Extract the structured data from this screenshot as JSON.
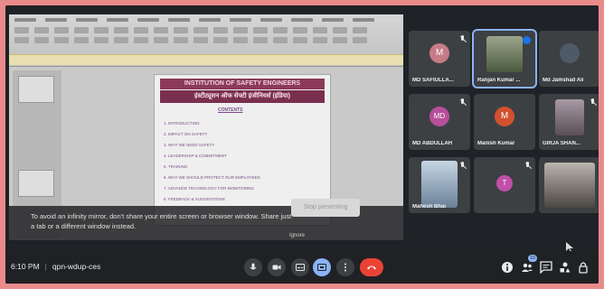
{
  "meeting": {
    "time": "6:10 PM",
    "code": "qpn-wdup-ces",
    "people_count": "10"
  },
  "presentation": {
    "slide_title_en": "INSTITUTION OF SAFETY ENGINEERS",
    "slide_title_hi": "इंस्टीट्यूशन ऑफ सेफ्टी इंजीनियर्स (इंडिया)",
    "contents_heading": "CONTENTS",
    "contents": [
      "1. INTRODUCTION",
      "2. IMPACT ON SAFETY",
      "3. WHY WE NEED SAFETY",
      "4. LEADERSHIP & COMMITMENT",
      "5. TRAINING",
      "6. WHY WE SHOULD PROTECT OUR EMPLOYEES",
      "7. ADVANCE TECHNOLOGY FOR MONITORING",
      "8. FEEDBACK & SUGGESTIONS"
    ],
    "warning_text": "To avoid an infinity mirror, don't share your entire screen or browser window. Share just a tab or a different window instead.",
    "stop_presenting_label": "Stop presenting",
    "ignore_label": "Ignore"
  },
  "participants": [
    {
      "name": "MD SAFIULLA...",
      "initial": "M",
      "color": "#c77b86",
      "muted": true,
      "type": "avatar"
    },
    {
      "name": "Ranjan Kumar ...",
      "initial": "",
      "color": "#6b7a5c",
      "muted": false,
      "type": "photo",
      "speaking": true
    },
    {
      "name": "Md Jamshad Ali",
      "initial": "",
      "color": "#5d6b7a",
      "muted": false,
      "type": "photo"
    },
    {
      "name": "MD ABDULLAH",
      "initial": "MD",
      "color": "#b74f9a",
      "muted": true,
      "type": "avatar"
    },
    {
      "name": "Manish Kumar",
      "initial": "M",
      "color": "#d2502f",
      "muted": false,
      "type": "avatar"
    },
    {
      "name": "GIRJA SHAN...",
      "initial": "",
      "color": "#7a6f78",
      "muted": true,
      "type": "photo"
    },
    {
      "name": "Mahesh Bhai",
      "initial": "",
      "color": "#8ea4b8",
      "muted": true,
      "type": "photo"
    },
    {
      "name": "",
      "initial": "T",
      "color": "#c14fa8",
      "muted": true,
      "type": "avatar"
    },
    {
      "name": "",
      "initial": "",
      "color": "#6e6a64",
      "muted": false,
      "type": "photo"
    }
  ],
  "icons": {
    "mic": "mic-icon",
    "camera": "camera-icon",
    "captions": "captions-icon",
    "present": "present-screen-icon",
    "more": "more-options-icon",
    "leave": "end-call-icon",
    "info": "info-icon",
    "people": "people-icon",
    "chat": "chat-icon",
    "activities": "activities-icon",
    "host": "host-controls-icon"
  },
  "colors": {
    "accent": "#8ab4f8",
    "end_call": "#ea4335"
  }
}
